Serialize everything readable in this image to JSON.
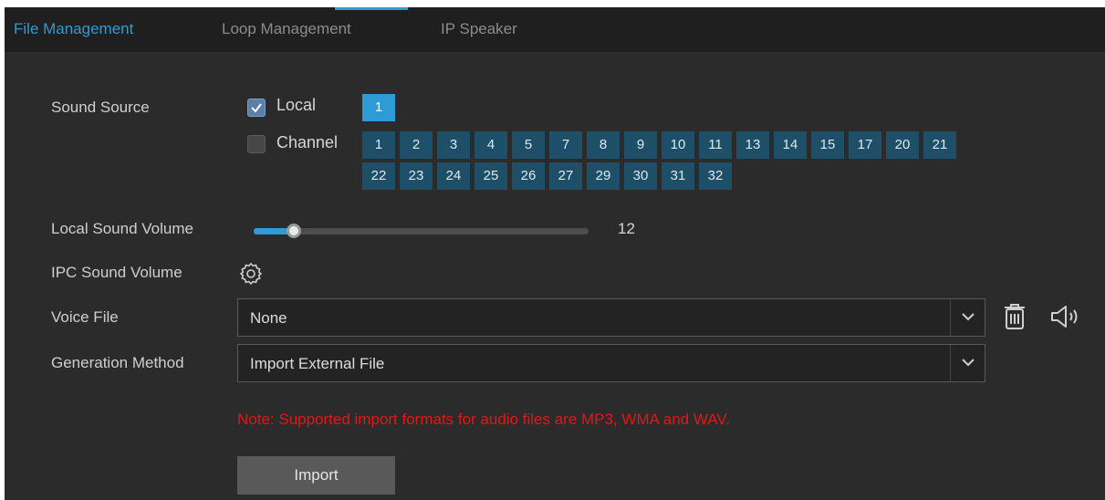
{
  "tabs": [
    {
      "label": "File Management",
      "active": true
    },
    {
      "label": "Loop Management",
      "active": false
    },
    {
      "label": "IP Speaker",
      "active": false
    }
  ],
  "sound_source": {
    "label": "Sound Source",
    "local": {
      "label": "Local",
      "checked": true,
      "buttons": [
        "1"
      ]
    },
    "channel": {
      "label": "Channel",
      "checked": false,
      "row1": [
        "1",
        "2",
        "3",
        "4",
        "5",
        "7",
        "8",
        "9",
        "10",
        "11",
        "13",
        "14",
        "15",
        "17",
        "20",
        "21"
      ],
      "row2": [
        "22",
        "23",
        "24",
        "25",
        "26",
        "27",
        "29",
        "30",
        "31",
        "32"
      ]
    }
  },
  "local_volume": {
    "label": "Local Sound Volume",
    "value": "12",
    "fraction": 0.12
  },
  "ipc_volume": {
    "label": "IPC Sound Volume",
    "icon": "gear-icon"
  },
  "voice_file": {
    "label": "Voice File",
    "value": "None",
    "delete_icon": "trash-icon",
    "play_icon": "speaker-icon"
  },
  "generation_method": {
    "label": "Generation Method",
    "value": "Import External File"
  },
  "note": "Note: Supported import formats for audio files are MP3, WMA and WAV.",
  "import_label": "Import",
  "colors": {
    "accent": "#2f9bd6",
    "channel_button": "#1e4f69",
    "note": "#e01818",
    "background": "#2b2b2b"
  }
}
